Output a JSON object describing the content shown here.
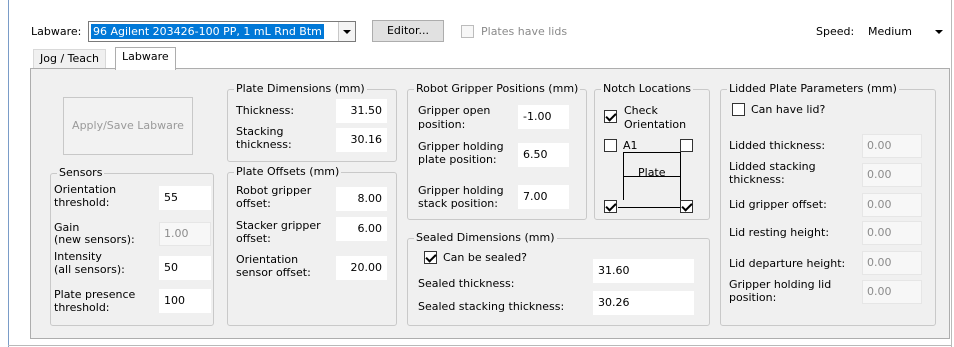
{
  "header": {
    "labware_label": "Labware:",
    "labware_value": "96 Agilent 203426-100 PP, 1 mL Rnd Btm",
    "editor_button": "Editor...",
    "plates_have_lids_label": "Plates have lids",
    "plates_have_lids_checked": false,
    "speed_label": "Speed:",
    "speed_value": "Medium"
  },
  "tabs": [
    {
      "label": "Jog / Teach",
      "active": false
    },
    {
      "label": "Labware",
      "active": true
    }
  ],
  "apply_button": "Apply/Save Labware",
  "sensors": {
    "title": "Sensors",
    "orientation_label_1": "Orientation",
    "orientation_label_2": "threshold:",
    "orientation_value": "55",
    "gain_label_1": "Gain",
    "gain_label_2": "(new sensors):",
    "gain_value": "1.00",
    "intensity_label_1": "Intensity",
    "intensity_label_2": "(all sensors):",
    "intensity_value": "50",
    "presence_label_1": "Plate presence",
    "presence_label_2": "threshold:",
    "presence_value": "100"
  },
  "plate_dimensions": {
    "title": "Plate Dimensions (mm)",
    "thickness_label": "Thickness:",
    "thickness_value": "31.50",
    "stacking_label_1": "Stacking",
    "stacking_label_2": "thickness:",
    "stacking_value": "30.16"
  },
  "plate_offsets": {
    "title": "Plate Offsets (mm)",
    "robot_label_1": "Robot gripper",
    "robot_label_2": "offset:",
    "robot_value": "8.00",
    "stacker_label_1": "Stacker gripper",
    "stacker_label_2": "offset:",
    "stacker_value": "6.00",
    "orientation_label_1": "Orientation",
    "orientation_label_2": "sensor offset:",
    "orientation_value": "20.00"
  },
  "gripper_positions": {
    "title": "Robot Gripper Positions (mm)",
    "open_label_1": "Gripper open",
    "open_label_2": "position:",
    "open_value": "-1.00",
    "plate_label_1": "Gripper holding",
    "plate_label_2": "plate position:",
    "plate_value": "6.50",
    "stack_label_1": "Gripper holding",
    "stack_label_2": "stack position:",
    "stack_value": "7.00"
  },
  "notch": {
    "title": "Notch Locations",
    "check_label_1": "Check",
    "check_label_2": "Orientation",
    "check_checked": true,
    "a1_label": "A1",
    "plate_label": "Plate",
    "corner_tl": false,
    "corner_tr": false,
    "corner_bl": true,
    "corner_br": true
  },
  "sealed": {
    "title": "Sealed Dimensions (mm)",
    "can_be_sealed_label": "Can be sealed?",
    "can_be_sealed_checked": true,
    "thickness_label": "Sealed thickness:",
    "thickness_value": "31.60",
    "stacking_label": "Sealed stacking thickness:",
    "stacking_value": "30.26"
  },
  "lidded": {
    "title": "Lidded Plate Parameters (mm)",
    "can_have_lid_label": "Can have lid?",
    "can_have_lid_checked": false,
    "thickness_label": "Lidded thickness:",
    "thickness_value": "0.00",
    "stacking_label_1": "Lidded stacking",
    "stacking_label_2": "thickness:",
    "stacking_value": "0.00",
    "gripper_offset_label": "Lid gripper offset:",
    "gripper_offset_value": "0.00",
    "resting_label": "Lid resting height:",
    "resting_value": "0.00",
    "departure_label": "Lid departure height:",
    "departure_value": "0.00",
    "holding_label_1": "Gripper holding lid",
    "holding_label_2": "position:",
    "holding_value": "0.00"
  },
  "colors": {
    "selection": "#0078d7",
    "panel_bg": "#f0f0f0",
    "window_border": "#7a9cc8"
  }
}
